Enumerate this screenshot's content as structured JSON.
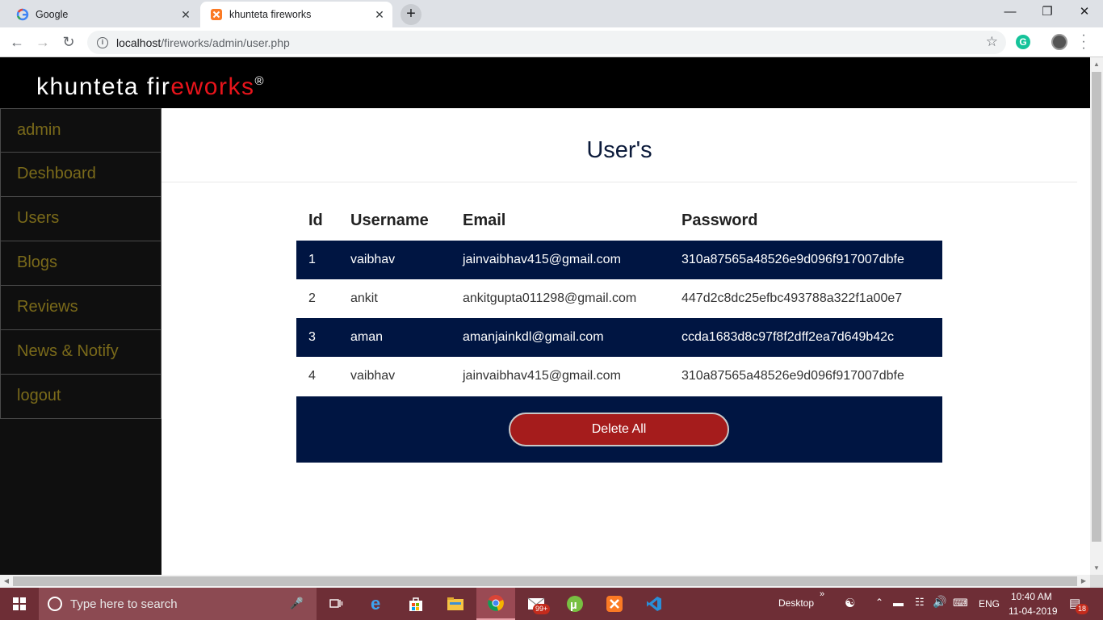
{
  "browser": {
    "tabs": [
      {
        "title": "Google",
        "icon": "google-icon",
        "active": false
      },
      {
        "title": "khunteta fireworks",
        "icon": "xampp-icon",
        "active": true
      }
    ],
    "url_host": "localhost",
    "url_path": "/fireworks/admin/user.php"
  },
  "site": {
    "logo_white": "khunteta fir",
    "logo_red": "eworks",
    "logo_mark": "®"
  },
  "sidebar": {
    "items": [
      {
        "label": "admin"
      },
      {
        "label": "Deshboard"
      },
      {
        "label": "Users"
      },
      {
        "label": "Blogs"
      },
      {
        "label": "Reviews"
      },
      {
        "label": "News & Notify"
      },
      {
        "label": "logout"
      }
    ]
  },
  "main": {
    "title": "User's",
    "table": {
      "headers": [
        "Id",
        "Username",
        "Email",
        "Password"
      ],
      "rows": [
        {
          "id": "1",
          "username": "vaibhav",
          "email": "jainvaibhav415@gmail.com",
          "password": "310a87565a48526e9d096f917007dbfe"
        },
        {
          "id": "2",
          "username": "ankit",
          "email": "ankitgupta011298@gmail.com",
          "password": "447d2c8dc25efbc493788a322f1a00e7"
        },
        {
          "id": "3",
          "username": "aman",
          "email": "amanjainkdl@gmail.com",
          "password": "ccda1683d8c97f8f2dff2ea7d649b42c"
        },
        {
          "id": "4",
          "username": "vaibhav",
          "email": "jainvaibhav415@gmail.com",
          "password": "310a87565a48526e9d096f917007dbfe"
        }
      ]
    },
    "delete_all_label": "Delete All"
  },
  "taskbar": {
    "search_placeholder": "Type here to search",
    "desktop_label": "Desktop",
    "lang": "ENG",
    "time": "10:40 AM",
    "date": "11-04-2019",
    "mail_badge": "99+",
    "notif_badge": "18"
  },
  "colors": {
    "navy": "#001542",
    "logo_red": "#e8141b",
    "delete_red": "#a51c1c",
    "sidebar_text": "#7a6a1a",
    "taskbar": "#6e2e36"
  }
}
